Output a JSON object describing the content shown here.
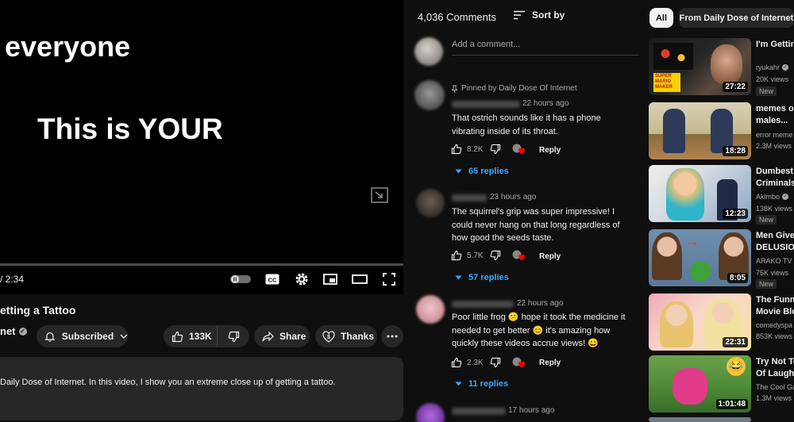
{
  "player": {
    "caption_line1": "everyone",
    "caption_line2": "This is YOUR",
    "time": "/ 2:34",
    "controls": [
      "pause-toggle-icon",
      "captions-icon",
      "settings-icon",
      "miniplayer-icon",
      "theater-icon",
      "fullscreen-icon"
    ]
  },
  "video": {
    "title": "etting a Tattoo",
    "channel": "net",
    "subscribed_label": "Subscribed",
    "likes": "133K",
    "share_label": "Share",
    "thanks_label": "Thanks",
    "description": "Daily Dose of Internet. In this video, I show you an extreme close up of getting a tattoo."
  },
  "comments": {
    "count": "4,036 Comments",
    "sort_label": "Sort by",
    "add_placeholder": "Add a comment...",
    "pinned_label": "Pinned by Daily Dose Of Internet",
    "reply_label": "Reply",
    "items": [
      {
        "time": "22 hours ago",
        "text": "That ostrich sounds like it has a phone vibrating inside of its throat.",
        "likes": "8.2K",
        "replies": "65 replies"
      },
      {
        "time": "23 hours ago",
        "text": "The squirrel's grip was super impressive! I could never hang on that long regardless of how good the seeds taste.",
        "likes": "5.7K",
        "replies": "57 replies"
      },
      {
        "time": "22 hours ago",
        "text": "Poor little frog 😕 hope it took the medicine it needed to get better 😊 it's amazing how quickly these videos accrue views! 😄",
        "likes": "2.3K",
        "replies": "11 replies"
      },
      {
        "time": "17 hours ago"
      }
    ]
  },
  "filters": {
    "all": "All",
    "from": "From Daily Dose of Internet"
  },
  "recommendations": [
    {
      "title": "I'm Getting TWISTED",
      "channel": "ryukahr",
      "views": "20K views",
      "badge": "New",
      "duration": "27:22",
      "thumb_text": "SUPER MARIO MAKER"
    },
    {
      "title": "memes or males...",
      "channel": "error meme",
      "views": "2.3M views",
      "badge": "",
      "duration": "18:28"
    },
    {
      "title": "Dumbest Criminals",
      "channel": "Akimbo",
      "views": "138K views",
      "badge": "New",
      "duration": "12:23"
    },
    {
      "title": "Men Give DELUSION",
      "channel": "ARAKO TV",
      "views": "75K views",
      "badge": "New",
      "duration": "8:05"
    },
    {
      "title": "The Funni Movie Blo",
      "channel": "comedyspa",
      "views": "853K views",
      "badge": "",
      "duration": "22:31"
    },
    {
      "title": "Try Not To Of Laught",
      "channel": "The Cool Ga",
      "views": "1.3M views",
      "badge": "",
      "duration": "1:01:48"
    }
  ],
  "colors": {
    "background": "#0f0f0f",
    "surface": "#272727",
    "link_blue": "#3ea6ff",
    "red_heart": "#ff0000"
  }
}
